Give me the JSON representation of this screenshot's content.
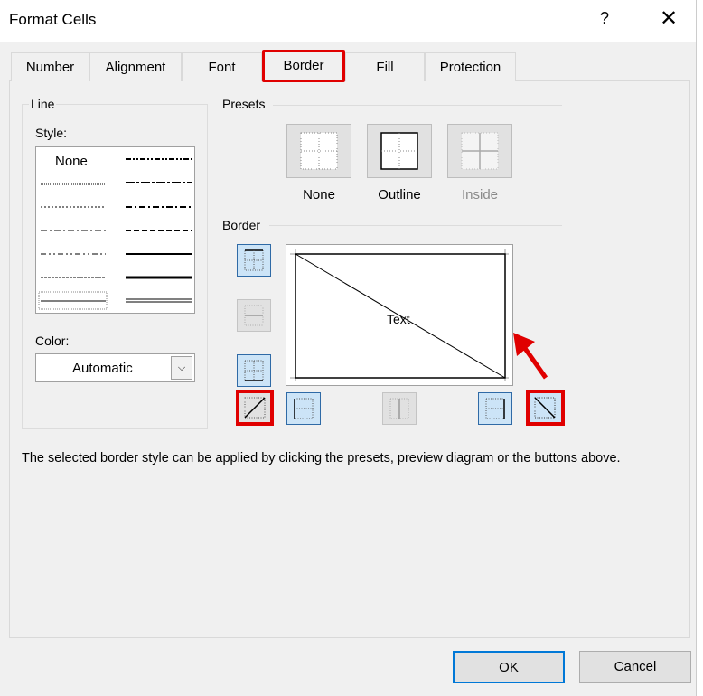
{
  "dialog": {
    "title": "Format Cells",
    "help_label": "?",
    "close_label": "✕"
  },
  "tabs": [
    {
      "label": "Number"
    },
    {
      "label": "Alignment"
    },
    {
      "label": "Font"
    },
    {
      "label": "Border",
      "active": true
    },
    {
      "label": "Fill"
    },
    {
      "label": "Protection"
    }
  ],
  "line": {
    "group_label": "Line",
    "style_label": "Style:",
    "style_none": "None",
    "color_label": "Color:",
    "color_value": "Automatic"
  },
  "presets": {
    "group_label": "Presets",
    "items": [
      {
        "label": "None"
      },
      {
        "label": "Outline"
      },
      {
        "label": "Inside",
        "disabled": true
      }
    ]
  },
  "border": {
    "group_label": "Border",
    "preview_text": "Text"
  },
  "hint": "The selected border style can be applied by clicking the presets, preview diagram or the buttons above.",
  "buttons": {
    "ok": "OK",
    "cancel": "Cancel"
  },
  "colors": {
    "highlight": "#e00000",
    "accent": "#cce4f7"
  }
}
